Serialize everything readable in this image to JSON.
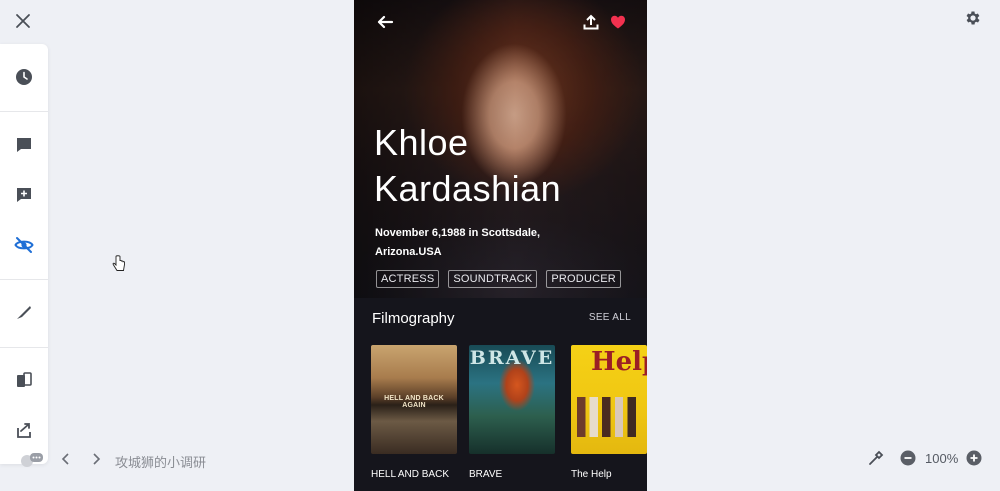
{
  "actor": {
    "name_line1": "Khloe",
    "name_line2": "Kardashian",
    "birth": "November 6,1988 in Scottsdale, Arizona.USA",
    "tags": [
      "ACTRESS",
      "SOUNDTRACK",
      "PRODUCER"
    ]
  },
  "filmography": {
    "title": "Filmography",
    "see_all": "SEE ALL",
    "movies": [
      {
        "label": "HELL AND BACK",
        "poster_text": "HELL AND BACK AGAIN"
      },
      {
        "label": "BRAVE",
        "poster_text": "BRAVE"
      },
      {
        "label": "The Help",
        "poster_text": "Help"
      }
    ]
  },
  "footer": {
    "author": "攻城狮的小调研",
    "zoom": "100%"
  },
  "colors": {
    "heart": "#f2314f",
    "accent_blue": "#1f6fd6",
    "icon_gray": "#4a4f57"
  }
}
